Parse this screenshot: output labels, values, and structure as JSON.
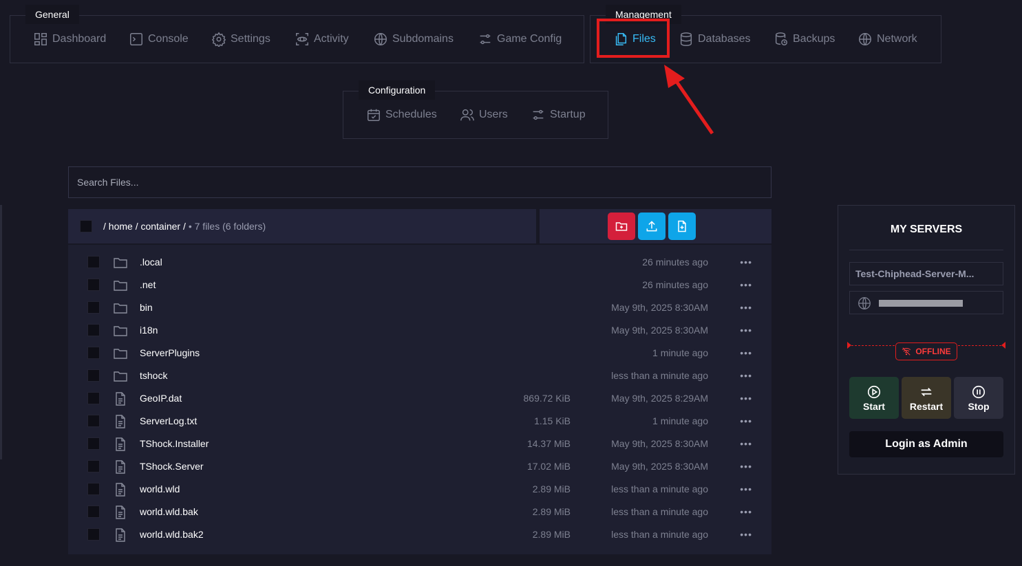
{
  "nav": {
    "general": {
      "title": "General",
      "items": [
        {
          "label": "Dashboard",
          "icon": "dashboard-icon"
        },
        {
          "label": "Console",
          "icon": "console-icon"
        },
        {
          "label": "Settings",
          "icon": "gear-icon"
        },
        {
          "label": "Activity",
          "icon": "activity-icon"
        },
        {
          "label": "Subdomains",
          "icon": "globe-icon"
        },
        {
          "label": "Game Config",
          "icon": "sliders-icon"
        }
      ]
    },
    "management": {
      "title": "Management",
      "items": [
        {
          "label": "Files",
          "icon": "files-icon",
          "active": true
        },
        {
          "label": "Databases",
          "icon": "database-icon"
        },
        {
          "label": "Backups",
          "icon": "backup-icon"
        },
        {
          "label": "Network",
          "icon": "globe-icon"
        }
      ]
    },
    "configuration": {
      "title": "Configuration",
      "items": [
        {
          "label": "Schedules",
          "icon": "calendar-icon"
        },
        {
          "label": "Users",
          "icon": "users-icon"
        },
        {
          "label": "Startup",
          "icon": "sliders-icon"
        }
      ]
    }
  },
  "annotation": {
    "highlight_color": "#e31d1d"
  },
  "search": {
    "placeholder": "Search Files..."
  },
  "breadcrumb": {
    "path": "/ home / container /",
    "meta": "• 7 files (6 folders)"
  },
  "actions": [
    {
      "name": "new-folder",
      "color": "#d41f3b",
      "icon": "folder-plus-icon"
    },
    {
      "name": "upload",
      "color": "#0ea5e9",
      "icon": "upload-icon"
    },
    {
      "name": "new-file",
      "color": "#0ea5e9",
      "icon": "file-plus-icon"
    }
  ],
  "files": [
    {
      "name": ".local",
      "type": "folder",
      "size": "",
      "modified": "26 minutes ago"
    },
    {
      "name": ".net",
      "type": "folder",
      "size": "",
      "modified": "26 minutes ago"
    },
    {
      "name": "bin",
      "type": "folder",
      "size": "",
      "modified": "May 9th, 2025 8:30AM"
    },
    {
      "name": "i18n",
      "type": "folder",
      "size": "",
      "modified": "May 9th, 2025 8:30AM"
    },
    {
      "name": "ServerPlugins",
      "type": "folder",
      "size": "",
      "modified": "1 minute ago"
    },
    {
      "name": "tshock",
      "type": "folder",
      "size": "",
      "modified": "less than a minute ago"
    },
    {
      "name": "GeoIP.dat",
      "type": "file",
      "size": "869.72 KiB",
      "modified": "May 9th, 2025 8:29AM"
    },
    {
      "name": "ServerLog.txt",
      "type": "file",
      "size": "1.15 KiB",
      "modified": "1 minute ago"
    },
    {
      "name": "TShock.Installer",
      "type": "file",
      "size": "14.37 MiB",
      "modified": "May 9th, 2025 8:30AM"
    },
    {
      "name": "TShock.Server",
      "type": "file",
      "size": "17.02 MiB",
      "modified": "May 9th, 2025 8:30AM"
    },
    {
      "name": "world.wld",
      "type": "file",
      "size": "2.89 MiB",
      "modified": "less than a minute ago"
    },
    {
      "name": "world.wld.bak",
      "type": "file",
      "size": "2.89 MiB",
      "modified": "less than a minute ago"
    },
    {
      "name": "world.wld.bak2",
      "type": "file",
      "size": "2.89 MiB",
      "modified": "less than a minute ago"
    }
  ],
  "row_menu_label": "•••",
  "servers_panel": {
    "title": "MY SERVERS",
    "server_name": "Test-Chiphead-Server-M...",
    "status": "OFFLINE",
    "buttons": [
      {
        "label": "Start",
        "color": "#1e3a2f",
        "icon": "play-icon"
      },
      {
        "label": "Restart",
        "color": "#3a3528",
        "icon": "restart-icon"
      },
      {
        "label": "Stop",
        "color": "#2c2d3c",
        "icon": "pause-icon"
      }
    ],
    "login_label": "Login as Admin"
  }
}
